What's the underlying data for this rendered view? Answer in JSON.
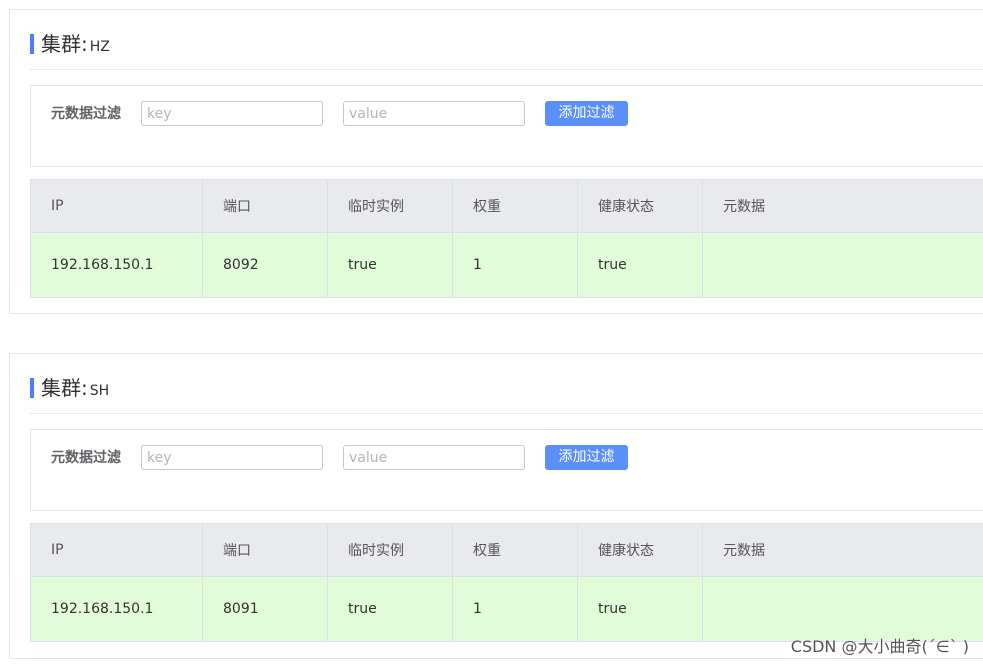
{
  "clusters": [
    {
      "label": "集群:",
      "name": "HZ",
      "filter": {
        "label": "元数据过滤",
        "key_placeholder": "key",
        "value_placeholder": "value",
        "button_label": "添加过滤"
      },
      "table": {
        "columns": [
          "IP",
          "端口",
          "临时实例",
          "权重",
          "健康状态",
          "元数据"
        ],
        "rows": [
          [
            "192.168.150.1",
            "8092",
            "true",
            "1",
            "true",
            ""
          ]
        ]
      }
    },
    {
      "label": "集群:",
      "name": "SH",
      "filter": {
        "label": "元数据过滤",
        "key_placeholder": "key",
        "value_placeholder": "value",
        "button_label": "添加过滤"
      },
      "table": {
        "columns": [
          "IP",
          "端口",
          "临时实例",
          "权重",
          "健康状态",
          "元数据"
        ],
        "rows": [
          [
            "192.168.150.1",
            "8091",
            "true",
            "1",
            "true",
            ""
          ]
        ]
      }
    }
  ],
  "colors": {
    "accent": "#4d7cfe",
    "button": "#5b8ff9",
    "header_bg": "#e9eaee",
    "healthy_row_bg": "#e1fcd9"
  },
  "watermark": "CSDN @大小曲奇(´∈`   )"
}
